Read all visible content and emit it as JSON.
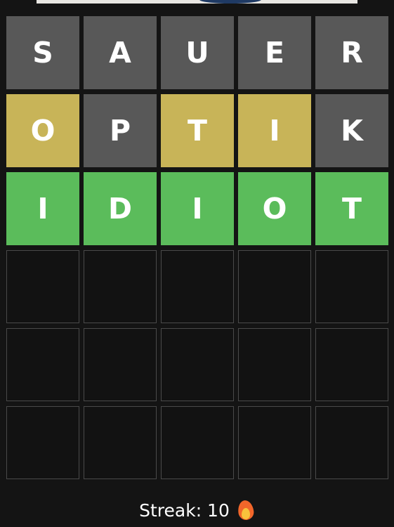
{
  "board": {
    "rows": [
      [
        {
          "letter": "S",
          "state": "absent"
        },
        {
          "letter": "A",
          "state": "absent"
        },
        {
          "letter": "U",
          "state": "absent"
        },
        {
          "letter": "E",
          "state": "absent"
        },
        {
          "letter": "R",
          "state": "absent"
        }
      ],
      [
        {
          "letter": "O",
          "state": "present"
        },
        {
          "letter": "P",
          "state": "absent"
        },
        {
          "letter": "T",
          "state": "present"
        },
        {
          "letter": "I",
          "state": "present"
        },
        {
          "letter": "K",
          "state": "absent"
        }
      ],
      [
        {
          "letter": "I",
          "state": "correct"
        },
        {
          "letter": "D",
          "state": "correct"
        },
        {
          "letter": "I",
          "state": "correct"
        },
        {
          "letter": "O",
          "state": "correct"
        },
        {
          "letter": "T",
          "state": "correct"
        }
      ],
      [
        {
          "letter": "",
          "state": "empty"
        },
        {
          "letter": "",
          "state": "empty"
        },
        {
          "letter": "",
          "state": "empty"
        },
        {
          "letter": "",
          "state": "empty"
        },
        {
          "letter": "",
          "state": "empty"
        }
      ],
      [
        {
          "letter": "",
          "state": "empty"
        },
        {
          "letter": "",
          "state": "empty"
        },
        {
          "letter": "",
          "state": "empty"
        },
        {
          "letter": "",
          "state": "empty"
        },
        {
          "letter": "",
          "state": "empty"
        }
      ],
      [
        {
          "letter": "",
          "state": "empty"
        },
        {
          "letter": "",
          "state": "empty"
        },
        {
          "letter": "",
          "state": "empty"
        },
        {
          "letter": "",
          "state": "empty"
        },
        {
          "letter": "",
          "state": "empty"
        }
      ]
    ]
  },
  "streak": {
    "label": "Streak: 10",
    "icon": "fire-icon"
  },
  "colors": {
    "background": "#141414",
    "absent": "#585858",
    "present": "#c8b458",
    "correct": "#5bbc5b",
    "empty_border": "#4a4a4a",
    "text": "#ffffff"
  }
}
